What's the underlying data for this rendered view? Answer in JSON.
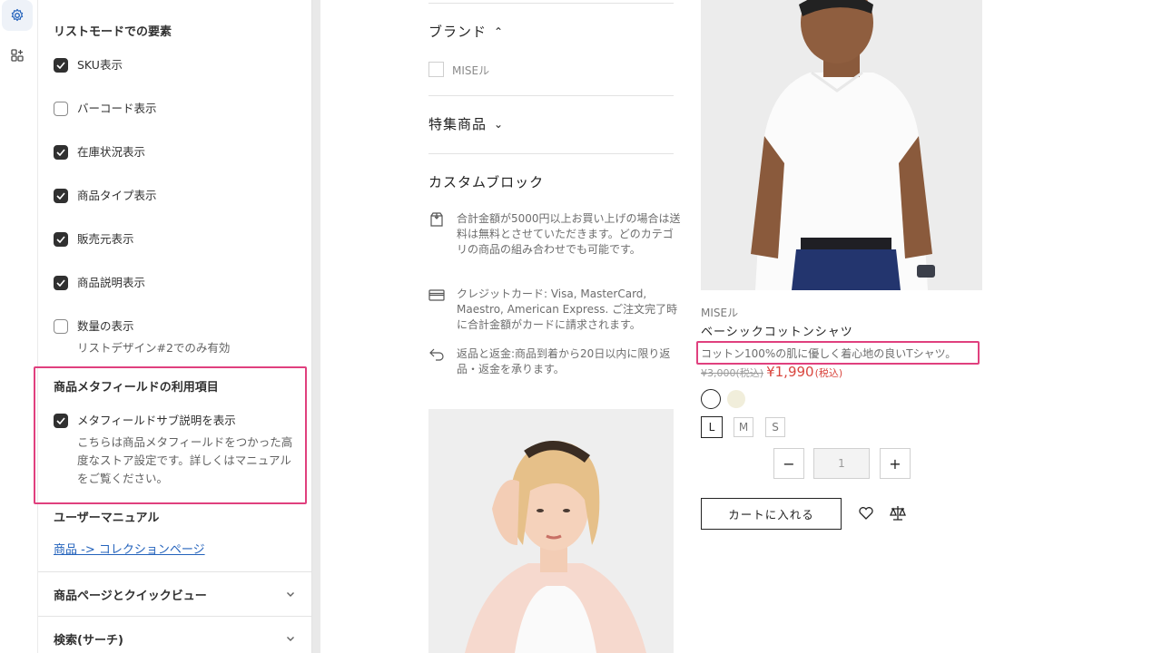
{
  "rail": {
    "icons": [
      "gear-icon",
      "apps-icon"
    ]
  },
  "panel": {
    "list_mode_title": "リストモードでの要素",
    "list_items": [
      {
        "label": "SKU表示",
        "checked": true
      },
      {
        "label": "バーコード表示",
        "checked": false
      },
      {
        "label": "在庫状況表示",
        "checked": true
      },
      {
        "label": "商品タイプ表示",
        "checked": true
      },
      {
        "label": "販売元表示",
        "checked": true
      },
      {
        "label": "商品説明表示",
        "checked": true
      },
      {
        "label": "数量の表示",
        "checked": false,
        "help": "リストデザイン#2でのみ有効"
      }
    ],
    "metafield_title": "商品メタフィールドの利用項目",
    "metafield_item": {
      "label": "メタフィールドサブ説明を表示",
      "checked": true,
      "help": "こちらは商品メタフィールドをつかった高度なストア設定です。詳しくはマニュアルをご覧ください。"
    },
    "manual_title": "ユーザーマニュアル",
    "manual_link": "商品 -> コレクションページ",
    "collapsed_sections": [
      "商品ページとクイックビュー",
      "検索(サーチ)"
    ]
  },
  "preview": {
    "filter_brand": "ブランド",
    "brand_option": "MISEル",
    "filter_featured": "特集商品",
    "custom_block_title": "カスタムブロック",
    "info": [
      {
        "icon": "package-icon",
        "text": "合計金額が5000円以上お買い上げの場合は送料は無料とさせていただきます。どのカテゴリの商品の組み合わせでも可能です。"
      },
      {
        "icon": "credit-card-icon",
        "text": "クレジットカード: Visa, MasterCard, Maestro, American Express. ご注文完了時に合計金額がカードに請求されます。"
      },
      {
        "icon": "return-arrow-icon",
        "text": "返品と返金:商品到着から20日以内に限り返品・返金を承ります。"
      }
    ],
    "product": {
      "vendor": "MISEル",
      "name": "ベーシックコットンシャツ",
      "description": "コットン100%の肌に優しく着心地の良いTシャツ。",
      "old_price": "¥3,000",
      "old_tax": "(税込)",
      "price": "¥1,990",
      "tax": "(税込)",
      "swatches": [
        "#ffffff",
        "#f1eedb"
      ],
      "sizes": [
        "L",
        "M",
        "S"
      ],
      "selected_size": "L",
      "qty_minus": "−",
      "qty": "1",
      "qty_plus": "+",
      "add_to_cart": "カートに入れる"
    }
  }
}
